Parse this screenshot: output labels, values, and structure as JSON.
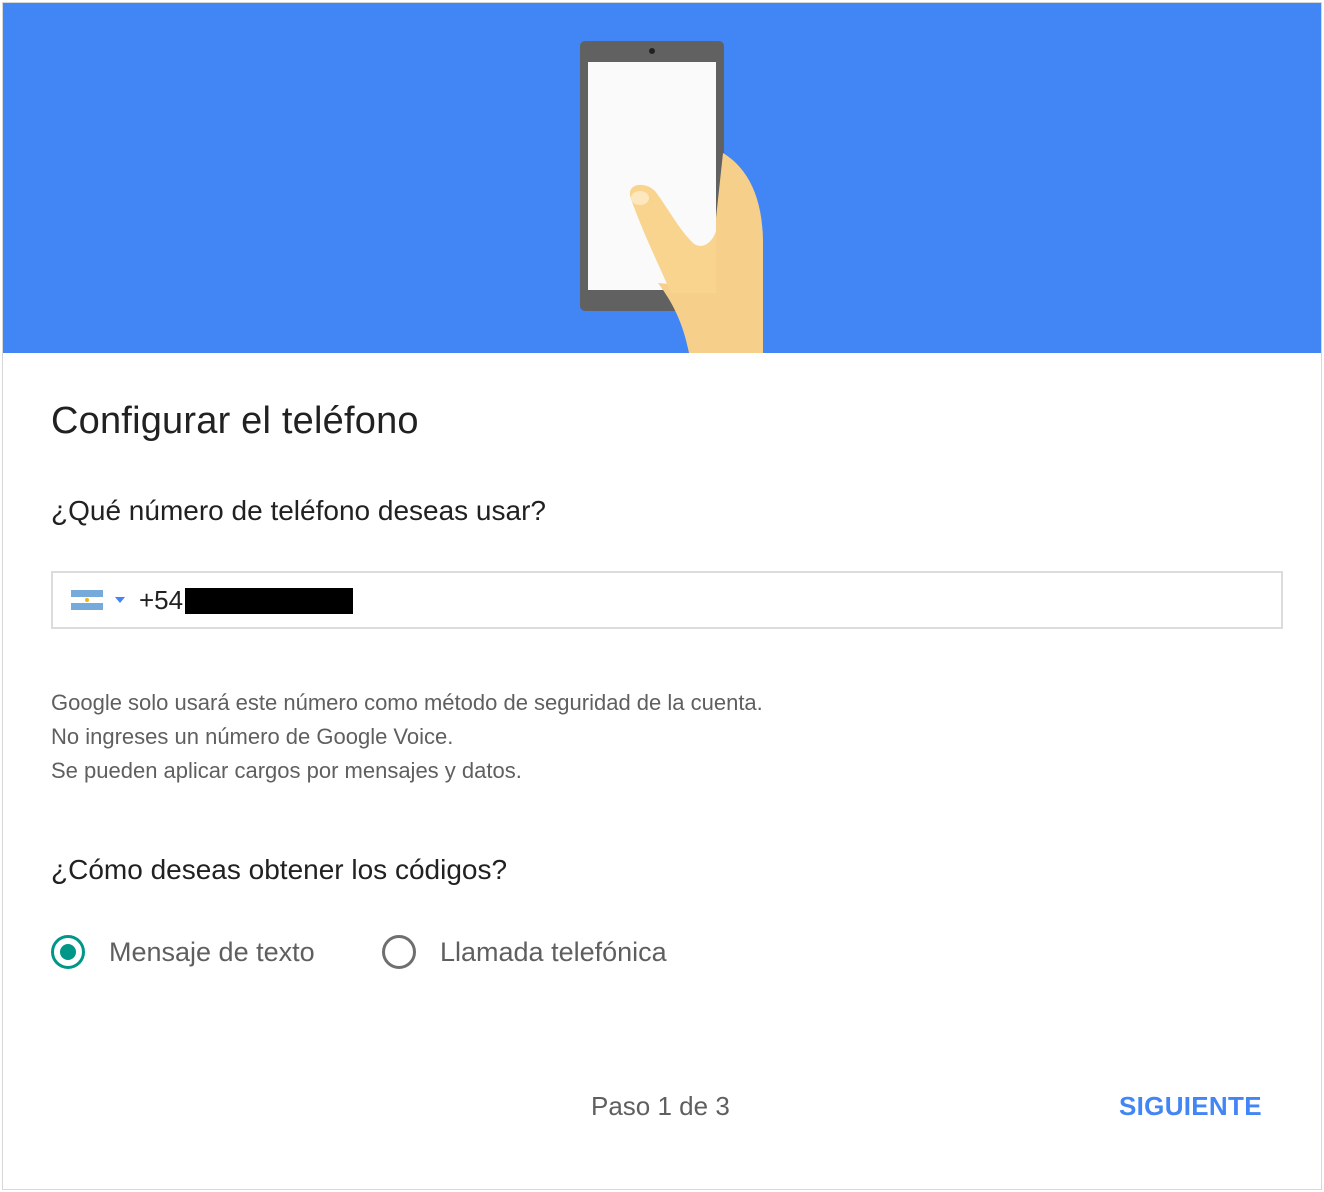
{
  "colors": {
    "banner": "#4285f4",
    "accent": "#4285f4",
    "radio_checked": "#009688"
  },
  "banner": {
    "illustration": "hand-holding-phone"
  },
  "header": {
    "title": "Configurar el teléfono"
  },
  "phone_section": {
    "question": "¿Qué número de teléfono deseas usar?",
    "country_flag": "argentina-flag-icon",
    "value": "+54"
  },
  "info": {
    "lines": [
      "Google solo usará este número como método de seguridad de la cuenta.",
      "No ingreses un número de Google Voice.",
      "Se pueden aplicar cargos por mensajes y datos."
    ]
  },
  "codes_section": {
    "question": "¿Cómo deseas obtener los códigos?",
    "options": [
      {
        "label": "Mensaje de texto",
        "selected": true
      },
      {
        "label": "Llamada telefónica",
        "selected": false
      }
    ]
  },
  "footer": {
    "step": "Paso 1 de 3",
    "next_label": "SIGUIENTE"
  }
}
